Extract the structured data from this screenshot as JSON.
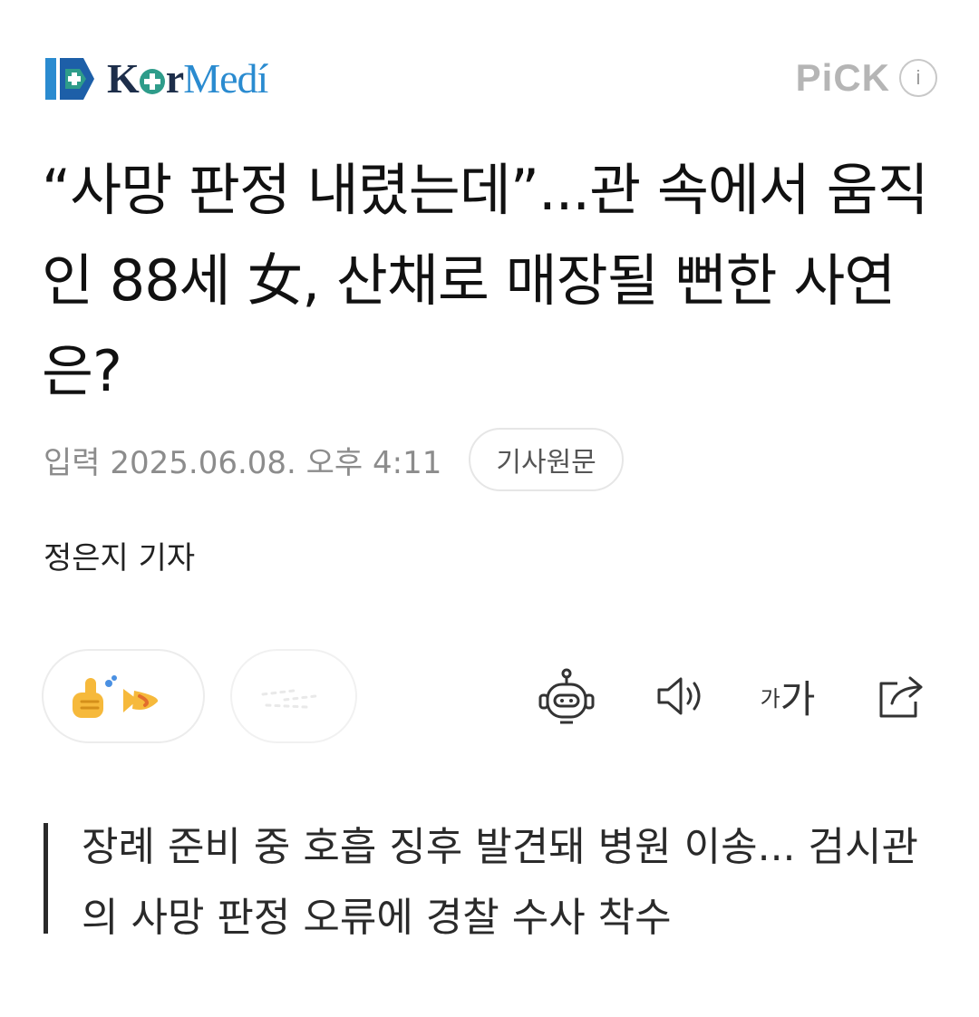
{
  "header": {
    "logo": "KorMedi",
    "pick_label": "PiCK",
    "info_label": "i"
  },
  "article": {
    "headline": "“사망 판정 내렸는데”...관 속에서 움직인 88세 女, 산채로 매장될 뻔한 사연은?",
    "published": "입력 2025.06.08. 오후 4:11",
    "original_button": "기사원문",
    "reporter": "정은지 기자",
    "summary": "장례 준비 중 호흡 징후 발견돼 병원 이송... 검시관의 사망 판정 오류에 경찰 수사 착수"
  },
  "toolbar": {
    "font_small": "가",
    "font_big": "가"
  },
  "icons": {
    "logo": "kormedi-logo-icon",
    "reaction_1": "thumbs-up-emoji-icon",
    "reaction_2": "reaction-emoji-icon",
    "robot": "robot-summary-icon",
    "sound": "speaker-icon",
    "share": "share-icon"
  },
  "colors": {
    "brand_navy": "#1d2e4a",
    "brand_teal": "#2e9c8a",
    "brand_blue": "#2a8bd0",
    "muted_text": "#8c8c8c"
  }
}
